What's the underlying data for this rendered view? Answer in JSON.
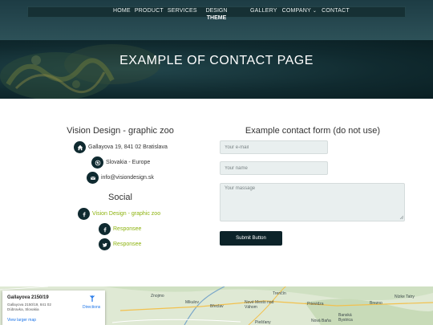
{
  "nav": {
    "left_items": [
      "HOME",
      "PRODUCT",
      "SERVICES"
    ],
    "logo_line1": "DESIGN",
    "logo_line2": "THEME",
    "right_items": [
      {
        "label": "GALLERY",
        "dropdown": false
      },
      {
        "label": "COMPANY",
        "dropdown": true
      },
      {
        "label": "CONTACT",
        "dropdown": false
      }
    ]
  },
  "banner": {
    "title": "EXAMPLE OF CONTACT PAGE"
  },
  "company": {
    "title": "Vision Design - graphic zoo",
    "address": "Gallayova 19, 841 02 Bratislava",
    "region": "Slovakia - Europe",
    "email": "info@visiondesign.sk"
  },
  "social": {
    "title": "Social",
    "facebook_page": "Vision Design - graphic zoo",
    "facebook_link": "Responsee",
    "twitter_link": "Responsee"
  },
  "form": {
    "title": "Example contact form (do not use)",
    "email_placeholder": "Your e-mail",
    "name_placeholder": "Your name",
    "message_placeholder": "Your massage",
    "submit_label": "Submit Button"
  },
  "map": {
    "card_title": "Gallayova 2150/19",
    "card_address": "Gallayova 2150/19, 841 02 Dúbravka, Slovakia",
    "directions_label": "Directions",
    "larger_map_label": "View larger map",
    "place_labels": [
      "Znojmo",
      "Mikulov",
      "Břeclav",
      "Trenčín",
      "Nové Mesto nad Váhom",
      "Prievidza",
      "Nová Baňa",
      "Banská Bystrica",
      "Brezno",
      "Piešťany",
      "Nízke Tatry"
    ]
  },
  "colors": {
    "header_dark": "#163034",
    "icon_bg": "#0f2a30",
    "link_green": "#8db30f",
    "button_bg": "#0c2329"
  }
}
